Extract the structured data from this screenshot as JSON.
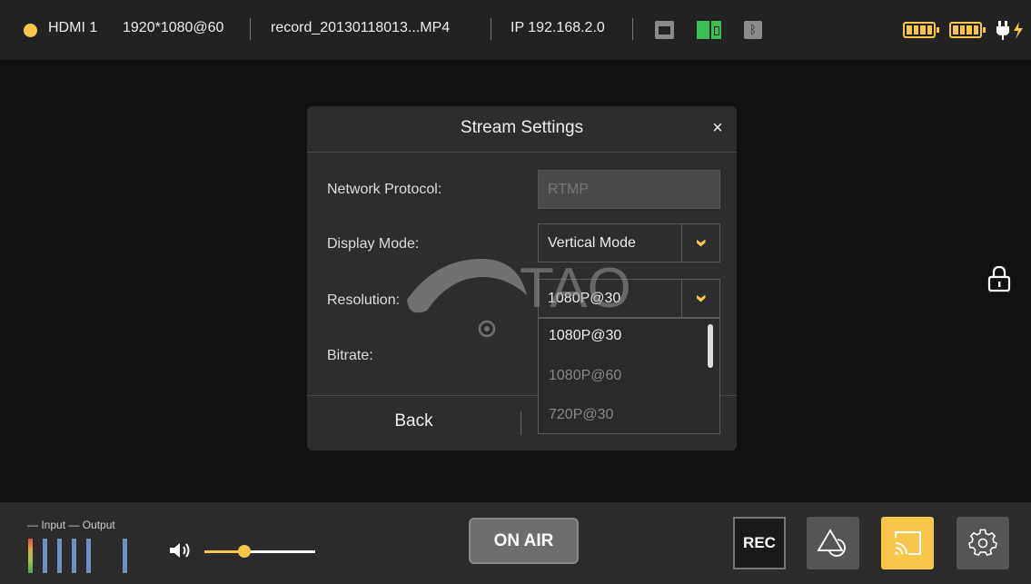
{
  "status_bar": {
    "source": "HDMI 1",
    "input_format": "1920*1080@60",
    "record_file": "record_20130118013...MP4",
    "ip": "IP 192.168.2.0",
    "icons": [
      "ethernet-icon",
      "sim-card-icon",
      "bluetooth-icon",
      "battery-icon",
      "battery-icon",
      "power-plug-icon"
    ],
    "battery_color": "#f7c64a",
    "sim_color": "#3cbf52"
  },
  "dialog": {
    "title": "Stream Settings",
    "close_glyph": "×",
    "rows": {
      "protocol_label": "Network Protocol:",
      "protocol_value": "RTMP",
      "display_label": "Display Mode:",
      "display_value": "Vertical Mode",
      "resolution_label": "Resolution:",
      "resolution_value": "1080P@30",
      "bitrate_label": "Bitrate:"
    },
    "resolution_options": [
      "1080P@30",
      "1080P@60",
      "720P@30"
    ],
    "back_label": "Back",
    "watermark_text": "TAO"
  },
  "bottom_bar": {
    "input_label": "Input",
    "output_label": "Output",
    "volume_level": 0.36,
    "onair_label": "ON AIR",
    "rec_label": "REC",
    "accent_color": "#f7c64a"
  }
}
